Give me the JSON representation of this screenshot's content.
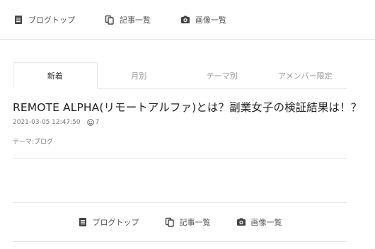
{
  "top_nav": {
    "items": [
      {
        "label": "ブログトップ",
        "icon": "document-icon"
      },
      {
        "label": "記事一覧",
        "icon": "copy-icon"
      },
      {
        "label": "画像一覧",
        "icon": "camera-icon"
      }
    ]
  },
  "tabs": [
    {
      "label": "新着",
      "active": true
    },
    {
      "label": "月別",
      "active": false
    },
    {
      "label": "テーマ別",
      "active": false
    },
    {
      "label": "アメンバー限定",
      "active": false
    }
  ],
  "article": {
    "title": "REMOTE ALPHA(リモートアルファ)とは？副業女子の検証結果は！？",
    "datetime": "2021-03-05 12:47:50",
    "reaction_icon": "smile-icon",
    "reaction_count": "7",
    "theme": "テーマ:ブログ"
  },
  "bottom_nav": {
    "items": [
      {
        "label": "ブログトップ",
        "icon": "document-icon"
      },
      {
        "label": "記事一覧",
        "icon": "copy-icon"
      },
      {
        "label": "画像一覧",
        "icon": "camera-icon"
      }
    ]
  },
  "colors": {
    "icon": "#444444",
    "muted_text": "#9a9a9a",
    "border": "#e6e6e6"
  }
}
